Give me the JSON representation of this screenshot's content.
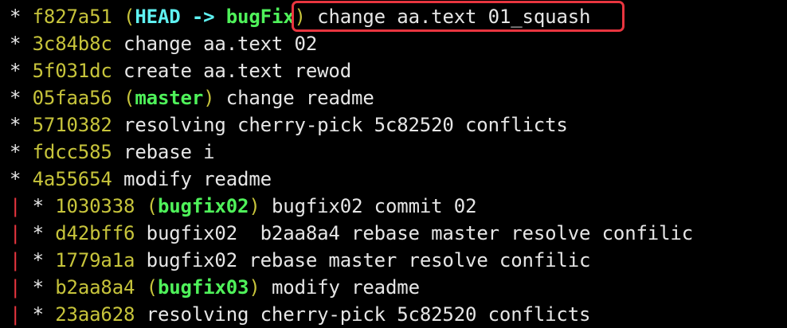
{
  "terminal": {
    "lines": [
      {
        "graph": "* ",
        "hash": "f827a51",
        "refs": [
          {
            "text": "HEAD -> ",
            "kind": "head"
          },
          {
            "text": "bugFix",
            "kind": "branch"
          }
        ],
        "message": "change aa.text 01_squash"
      },
      {
        "graph": "* ",
        "hash": "3c84b8c",
        "refs": [],
        "message": "change aa.text 02"
      },
      {
        "graph": "* ",
        "hash": "5f031dc",
        "refs": [],
        "message": "create aa.text rewod"
      },
      {
        "graph": "* ",
        "hash": "05faa56",
        "refs": [
          {
            "text": "master",
            "kind": "branch"
          }
        ],
        "message": "change readme"
      },
      {
        "graph": "* ",
        "hash": "5710382",
        "refs": [],
        "message": "resolving cherry-pick 5c82520 conflicts"
      },
      {
        "graph": "* ",
        "hash": "fdcc585",
        "refs": [],
        "message": "rebase i"
      },
      {
        "graph": "* ",
        "hash": "4a55654",
        "refs": [],
        "message": "modify readme"
      },
      {
        "graph": "| * ",
        "hash": "1030338",
        "refs": [
          {
            "text": "bugfix02",
            "kind": "branch"
          }
        ],
        "message": "bugfix02 commit 02"
      },
      {
        "graph": "| * ",
        "hash": "d42bff6",
        "refs": [],
        "message": "bugfix02  b2aa8a4 rebase master resolve confilic"
      },
      {
        "graph": "| * ",
        "hash": "1779a1a",
        "refs": [],
        "message": "bugfix02 rebase master resolve confilic"
      },
      {
        "graph": "| * ",
        "hash": "b2aa8a4",
        "refs": [
          {
            "text": "bugfix03",
            "kind": "branch"
          }
        ],
        "message": "modify readme"
      },
      {
        "graph": "| * ",
        "hash": "23aa628",
        "refs": [],
        "message": "resolving cherry-pick 5c82520 conflicts"
      }
    ]
  },
  "colors": {
    "background": "#000000",
    "text": "#e6e6e6",
    "hash": "#c7c43b",
    "head": "#5ff2f2",
    "branch": "#4ff25a",
    "graph_branch": "#e8353f",
    "highlight": "#e8353f"
  }
}
